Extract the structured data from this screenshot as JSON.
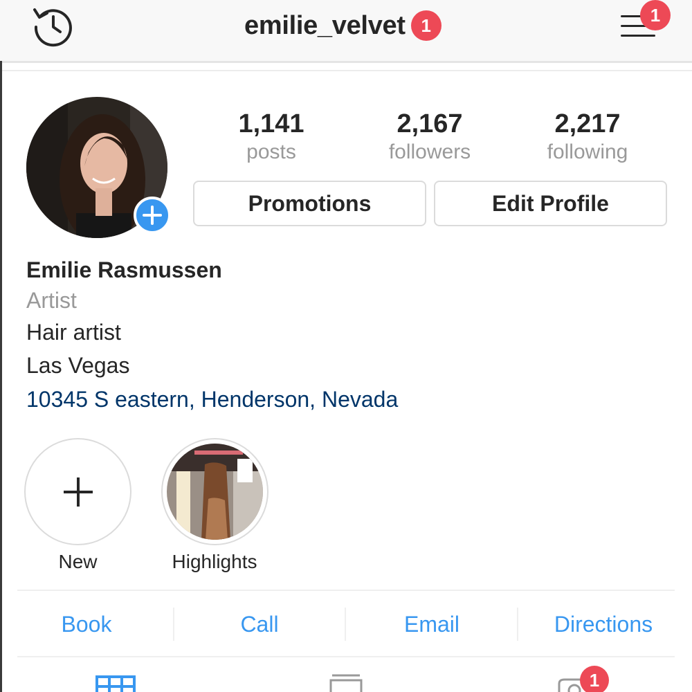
{
  "header": {
    "username": "emilie_velvet",
    "account_badge": "1",
    "menu_badge": "1",
    "icons": {
      "history": "history-icon",
      "menu": "hamburger-menu-icon"
    }
  },
  "profile": {
    "stats": [
      {
        "value": "1,141",
        "label": "posts"
      },
      {
        "value": "2,167",
        "label": "followers"
      },
      {
        "value": "2,217",
        "label": "following"
      }
    ],
    "buttons": {
      "promotions": "Promotions",
      "edit_profile": "Edit Profile"
    },
    "name": "Emilie Rasmussen",
    "category": "Artist",
    "bio_line_1": "Hair artist",
    "bio_line_2": "Las Vegas",
    "address": "10345 S eastern, Henderson, Nevada"
  },
  "highlights": [
    {
      "label": "New",
      "icon": "plus-icon"
    },
    {
      "label": "Highlights",
      "icon": "highlight-thumbnail"
    }
  ],
  "actions": [
    "Book",
    "Call",
    "Email",
    "Directions"
  ],
  "tabs": {
    "items": [
      "grid-icon",
      "feed-icon",
      "tagged-icon"
    ],
    "tagged_badge": "1"
  },
  "colors": {
    "accent_blue": "#3897f0",
    "badge_red": "#ed4956",
    "link_navy": "#003569",
    "muted_gray": "#999999"
  }
}
